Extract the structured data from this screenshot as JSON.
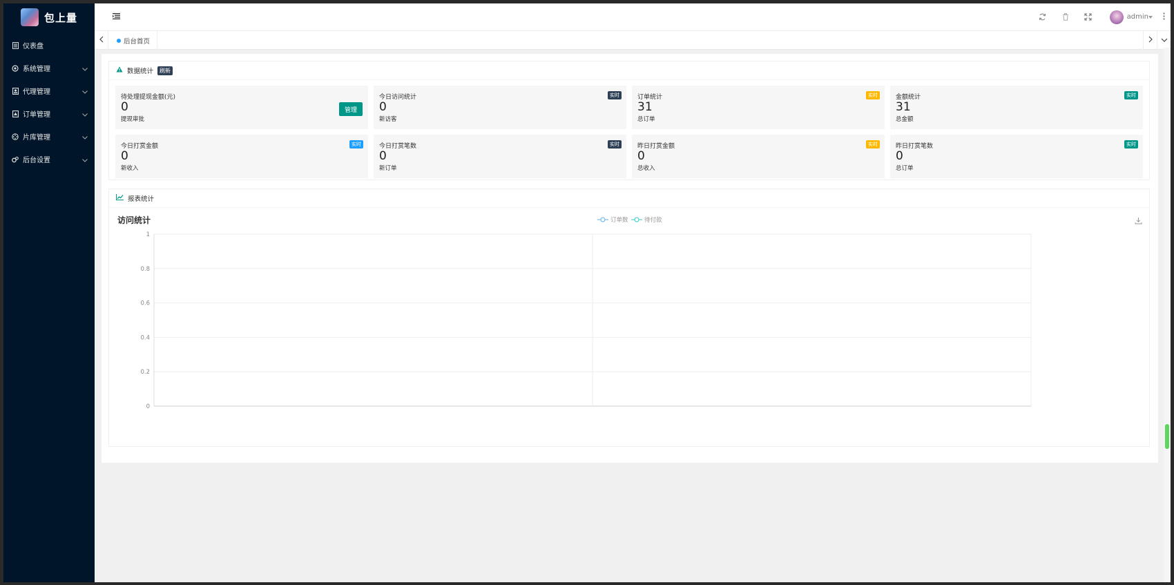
{
  "app": {
    "name": "包上量"
  },
  "sidebar": {
    "items": [
      {
        "label": "仪表盘",
        "icon": "dashboard-icon",
        "has_children": false
      },
      {
        "label": "系统管理",
        "icon": "gear-icon",
        "has_children": true
      },
      {
        "label": "代理管理",
        "icon": "agent-icon",
        "has_children": true
      },
      {
        "label": "订单管理",
        "icon": "order-icon",
        "has_children": true
      },
      {
        "label": "片库管理",
        "icon": "film-icon",
        "has_children": true
      },
      {
        "label": "后台设置",
        "icon": "settings-icon",
        "has_children": true
      }
    ]
  },
  "header": {
    "user": "admin"
  },
  "tabs": {
    "items": [
      {
        "label": "后台首页",
        "active": true
      }
    ]
  },
  "stats_panel": {
    "title": "数据统计",
    "refresh_badge": "刷新",
    "cards": [
      {
        "title": "待处理提现金额(元)",
        "value": "0",
        "sub": "提现审批",
        "button": "管理"
      },
      {
        "title": "今日访问统计",
        "value": "0",
        "sub": "新访客",
        "badge": "实时",
        "badge_color": "#2f4056"
      },
      {
        "title": "订单统计",
        "value": "31",
        "sub": "总订单",
        "badge": "实时",
        "badge_color": "#ffb800"
      },
      {
        "title": "金额统计",
        "value": "31",
        "sub": "总金额",
        "badge": "实时",
        "badge_color": "#009688"
      },
      {
        "title": "今日打赏金额",
        "value": "0",
        "sub": "新收入",
        "badge": "实时",
        "badge_color": "#1e9fff"
      },
      {
        "title": "今日打赏笔数",
        "value": "0",
        "sub": "新订单",
        "badge": "实时",
        "badge_color": "#2f4056"
      },
      {
        "title": "昨日打赏金额",
        "value": "0",
        "sub": "总收入",
        "badge": "实时",
        "badge_color": "#ffb800"
      },
      {
        "title": "昨日打赏笔数",
        "value": "0",
        "sub": "总订单",
        "badge": "实时",
        "badge_color": "#009688"
      }
    ]
  },
  "report_panel": {
    "title": "报表统计"
  },
  "chart_data": {
    "type": "line",
    "title": "访问统计",
    "categories": [
      "",
      ""
    ],
    "series": [
      {
        "name": "订单数",
        "color": "#5ab1ef",
        "values": []
      },
      {
        "name": "待付款",
        "color": "#2ec7c9",
        "values": []
      }
    ],
    "ylim": [
      0,
      1
    ],
    "yticks": [
      "0",
      "0.2",
      "0.4",
      "0.6",
      "0.8",
      "1"
    ],
    "grid": true,
    "legend": "top-center"
  }
}
